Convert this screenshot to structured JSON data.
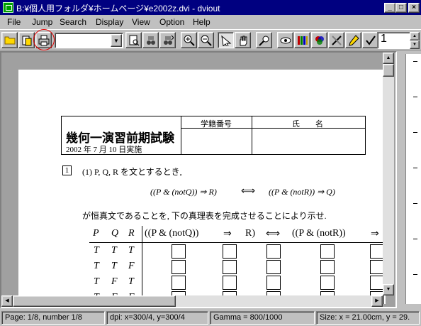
{
  "window": {
    "title": "B:¥個人用フォルダ¥ホームページ¥e2002z.dvi - dviout",
    "min_glyph": "_",
    "max_glyph": "□",
    "close_glyph": "×"
  },
  "menu": [
    "File",
    "Jump",
    "Search",
    "Display",
    "View",
    "Option",
    "Help"
  ],
  "toolbar": {
    "file_combo_value": "",
    "page_spin_value": "1",
    "icons": [
      "open-folder-icon",
      "recent-files-icon",
      "print-icon",
      "preview-icon",
      "search-icon",
      "search-next-icon",
      "zoom-in-icon",
      "zoom-out-icon",
      "select-arrow-icon",
      "hand-icon",
      "magnifier-icon",
      "eye-icon",
      "library-icon",
      "color-icon",
      "tools-icon",
      "pencil-icon",
      "check-icon"
    ],
    "highlight_color": "#e00000"
  },
  "document": {
    "exam_title": "幾何一演習前期試験",
    "exam_date": "2002 年 7 月 10 日実施",
    "student_id_header": "学籍番号",
    "name_header": "氏　　名",
    "question_number": "1",
    "q1_intro": "(1)  P, Q, R を文とするとき,",
    "formula_left": "((P & (notQ)) ⇒ R)",
    "formula_iff": "⟺",
    "formula_right": "((P & (notR)) ⇒ Q)",
    "instruction": "が恒真文であることを, 下の真理表を完成させることにより示せ.",
    "table_headers": [
      "P",
      "Q",
      "R",
      "((P & (notQ))",
      "⇒",
      "R)",
      "⟺",
      "((P & (notR))",
      "⇒"
    ],
    "rows": [
      [
        "T",
        "T",
        "T"
      ],
      [
        "T",
        "T",
        "F"
      ],
      [
        "T",
        "F",
        "T"
      ],
      [
        "T",
        "F",
        "F"
      ]
    ]
  },
  "status": {
    "page": "Page: 1/8, number 1/8",
    "dpi": "dpi: x=300/4, y=300/4",
    "gamma": "Gamma = 800/1000",
    "size": "Size: x = 21.00cm, y = 29."
  }
}
